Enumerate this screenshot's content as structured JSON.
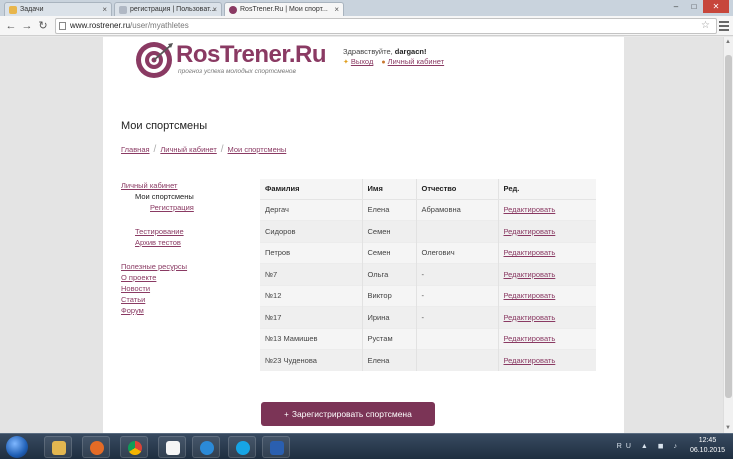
{
  "browser": {
    "tabs": [
      {
        "label": "Задачи",
        "active": false
      },
      {
        "label": "регистрация | Пользоват...",
        "active": false
      },
      {
        "label": "RosTrener.Ru | Мои спорт...",
        "active": true
      }
    ],
    "window_buttons": {
      "min": "–",
      "max": "□",
      "close": "✕"
    },
    "url_host": "www.rostrener.ru",
    "url_path": "/user/myathletes"
  },
  "site": {
    "logo_text": "RosTrener.Ru",
    "tagline": "прогноз успеха молодых спортсменов",
    "welcome_prefix": "Здравствуйте,",
    "username": "dargacn!",
    "logout_label": "Выход",
    "cabinet_label": "Личный кабинет",
    "brand_color": "#8a3a63"
  },
  "page": {
    "title": "Мои спортсмены",
    "breadcrumbs": [
      "Главная",
      "Личный кабинет",
      "Мои спортсмены"
    ]
  },
  "leftnav": {
    "cabinet": "Личный кабинет",
    "my_athletes": "Мои спортсмены",
    "registration": "Регистрация",
    "testing": "Тестирование",
    "test_archive": "Архив тестов",
    "useful": "Полезные ресурсы",
    "about": "О проекте",
    "news": "Новости",
    "articles": "Статьи",
    "forum": "Форум"
  },
  "table": {
    "headers": [
      "Фамилия",
      "Имя",
      "Отчество",
      "Ред."
    ],
    "edit_label": "Редактировать",
    "rows": [
      [
        "Дергач",
        "Елена",
        "Абрамовна"
      ],
      [
        "Сидоров",
        "Семен",
        ""
      ],
      [
        "Петров",
        "Семен",
        "Олегович"
      ],
      [
        "№7",
        "Ольга",
        "-"
      ],
      [
        "№12",
        "Виктор",
        "-"
      ],
      [
        "№17",
        "Ирина",
        "-"
      ],
      [
        "№13 Мамишев",
        "Рустам",
        ""
      ],
      [
        "№23 Чуденова",
        "Елена",
        ""
      ]
    ]
  },
  "register_button": {
    "label": "Зарегистрировать спортсмена",
    "plus": "+"
  },
  "taskbar": {
    "time": "12:45",
    "date": "06.10.2015",
    "lang": "RU"
  }
}
